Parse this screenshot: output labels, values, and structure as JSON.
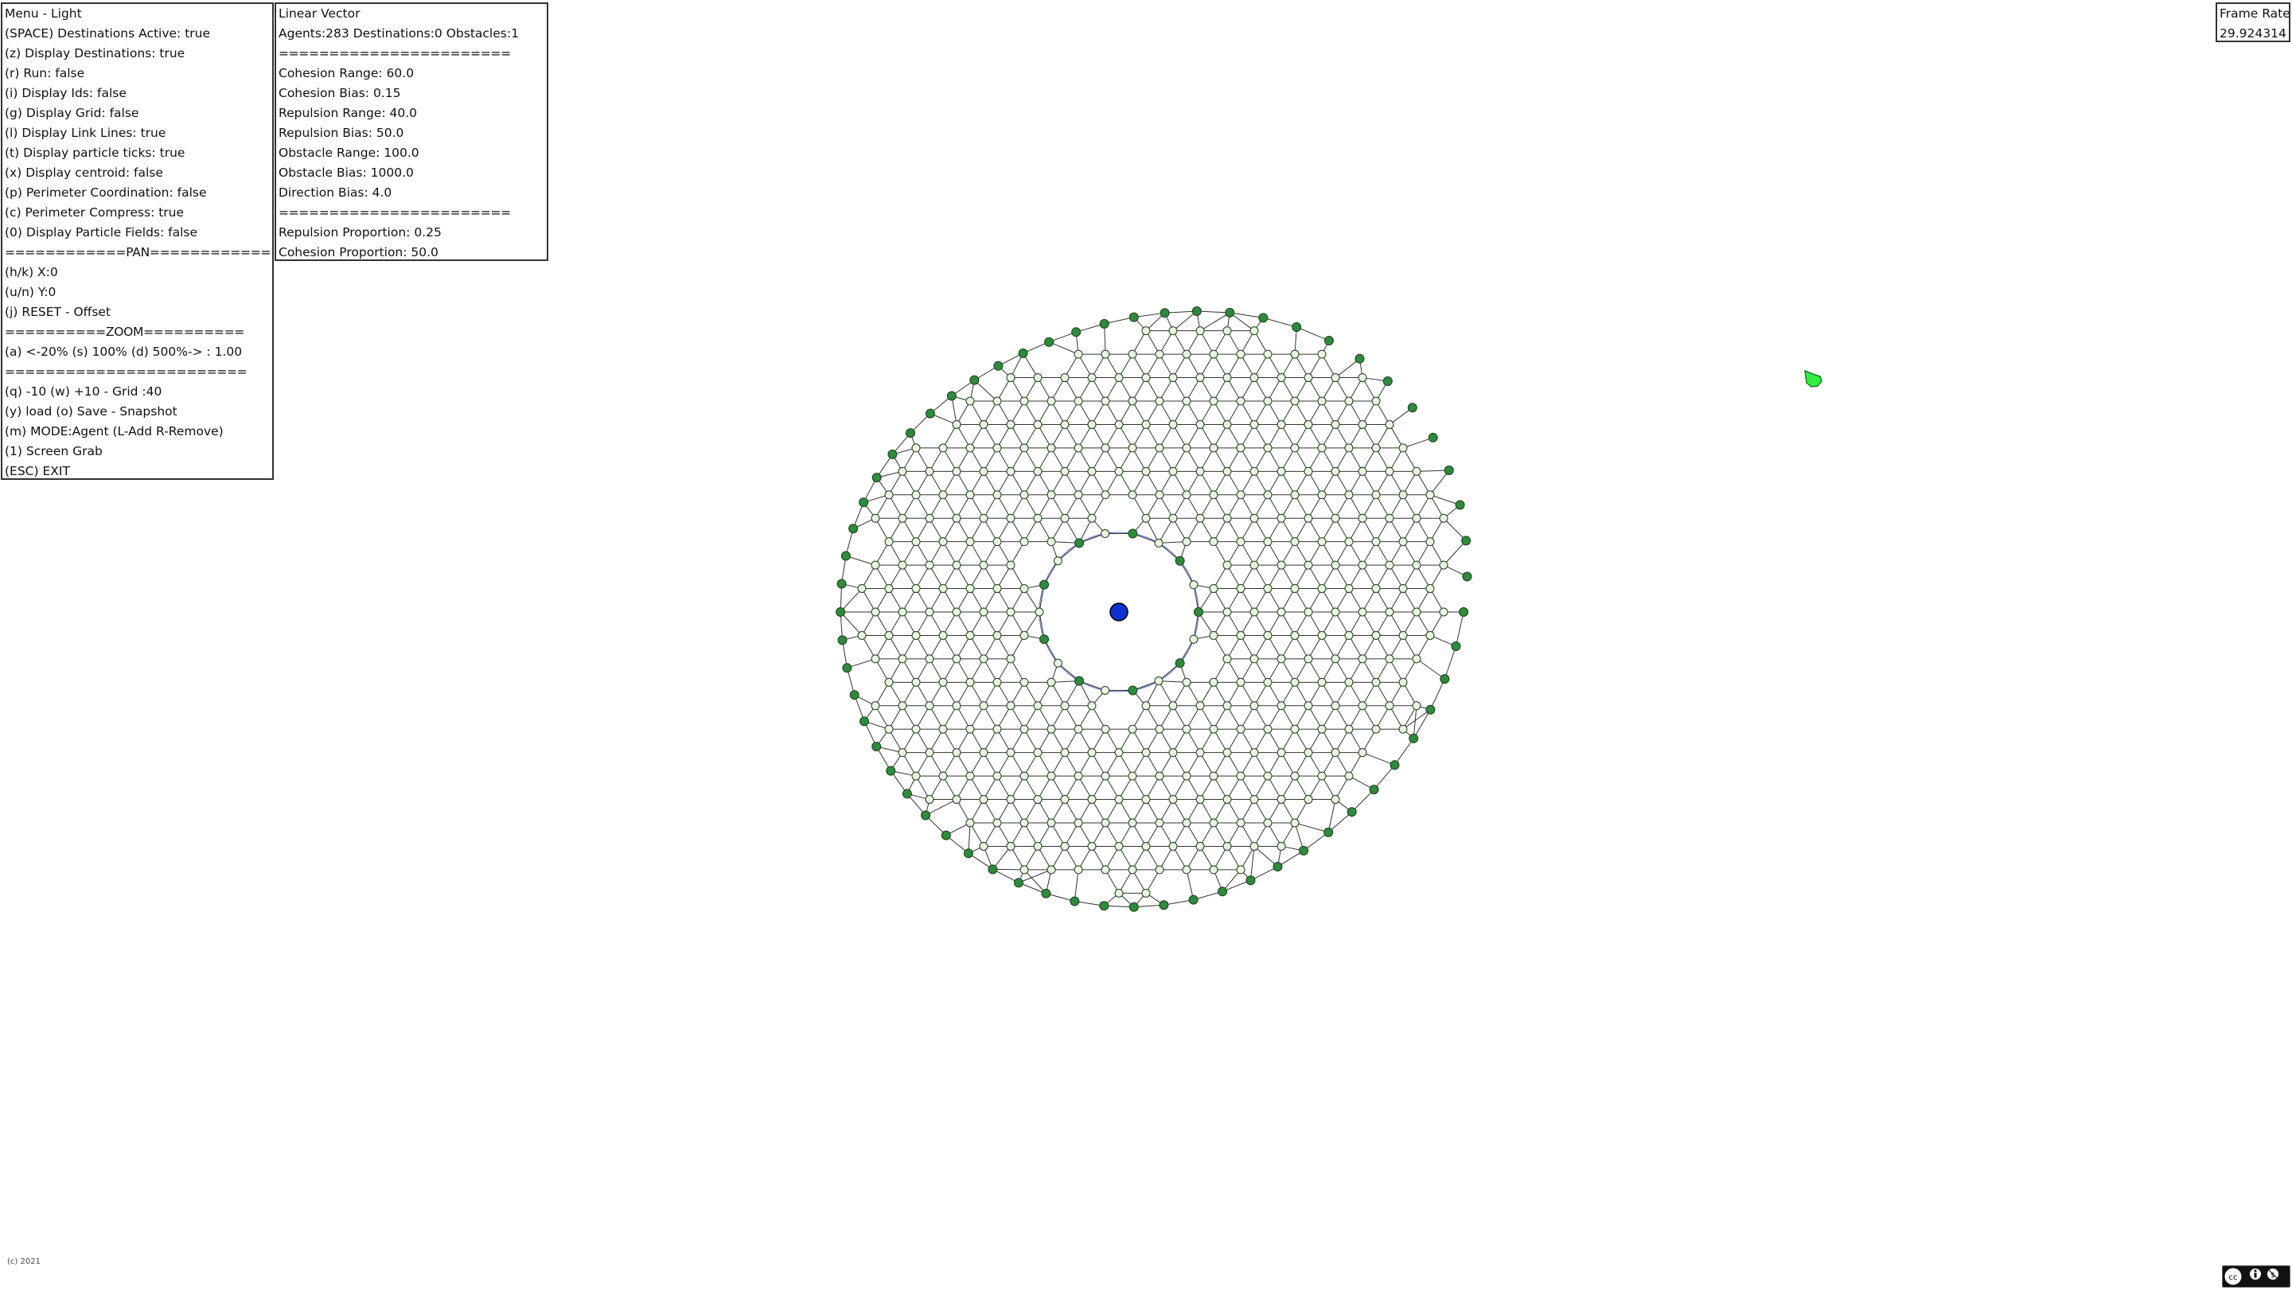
{
  "menu": {
    "title": "Menu - Light",
    "items": [
      "(SPACE) Destinations Active: true",
      "(z) Display Destinations: true",
      "(r) Run: false",
      "(i) Display Ids: false",
      "(g) Display Grid: false",
      "(l) Display Link Lines: true",
      "(t) Display particle ticks: true",
      "(x) Display centroid: false",
      "(p) Perimeter Coordination: false",
      "(c) Perimeter Compress: true",
      "(0) Display Particle Fields: false",
      "============PAN============",
      "(h/k) X:0",
      "(u/n) Y:0",
      "(j) RESET - Offset",
      "==========ZOOM==========",
      "(a) <-20% (s) 100% (d) 500%-> : 1.00",
      "========================",
      "(q) -10 (w) +10 - Grid :40",
      "(y) load (o) Save - Snapshot",
      "(m) MODE:Agent (L-Add R-Remove)",
      "(1) Screen Grab",
      "(ESC) EXIT"
    ]
  },
  "vector": {
    "title": "Linear Vector",
    "items": [
      "Agents:283 Destinations:0 Obstacles:1",
      "=======================",
      "Cohesion Range: 60.0",
      "Cohesion Bias: 0.15",
      "Repulsion Range: 40.0",
      "Repulsion Bias: 50.0",
      "Obstacle Range: 100.0",
      "Obstacle Bias: 1000.0",
      "Direction Bias: 4.0",
      "=======================",
      "Repulsion Proportion: 0.25",
      "Cohesion Proportion: 50.0"
    ]
  },
  "frame_rate": {
    "label": "Frame Rate",
    "value": "29.924314"
  },
  "footer": {
    "copyright": "(c) 2021"
  },
  "colors": {
    "perimeter_agent": "#2e8b3c",
    "inner_agent": "#e8f7e0",
    "link_line": "#333333",
    "obstacle": "#1030d0",
    "destination": "#33ee44"
  },
  "icons": {
    "cc_badge": "creative-commons-by-nc-icon"
  }
}
